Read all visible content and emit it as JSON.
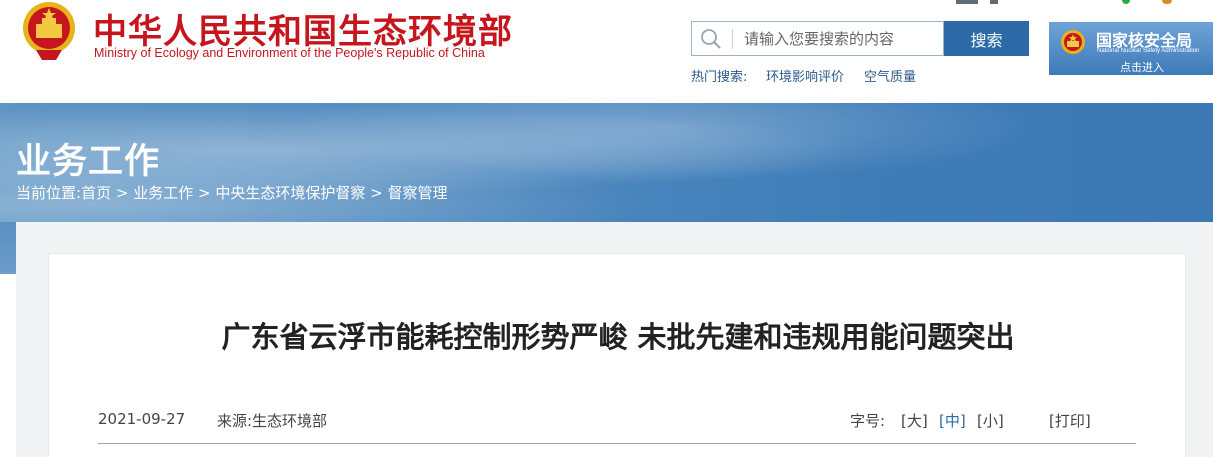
{
  "site": {
    "title": "中华人民共和国生态环境部",
    "subtitle": "Ministry of Ecology and Environment of the People's Republic of China"
  },
  "search": {
    "placeholder": "请输入您要搜索的内容",
    "button_label": "搜索",
    "hot_label": "热门搜索:",
    "hot_links": [
      "环境影响评价",
      "空气质量"
    ]
  },
  "nuclear_banner": {
    "title": "国家核安全局",
    "english": "National Nuclear Safety Administration",
    "enter": "点击进入"
  },
  "banner": {
    "title": "业务工作",
    "breadcrumb": {
      "prefix": "当前位置:",
      "items": [
        "首页",
        "业务工作",
        "中央生态环境保护督察",
        "督察管理"
      ],
      "separator": ">"
    }
  },
  "article": {
    "title": "广东省云浮市能耗控制形势严峻 未批先建和违规用能问题突出",
    "date": "2021-09-27",
    "source": "来源:生态环境部",
    "fontsize_label": "字号:",
    "fontsize_options": [
      "[大]",
      "[中]",
      "[小]"
    ],
    "fontsize_active": "[中]",
    "print_label": "[打印]"
  },
  "colors": {
    "brand_red": "#c4161c",
    "accent_blue": "#2c6aa8"
  }
}
